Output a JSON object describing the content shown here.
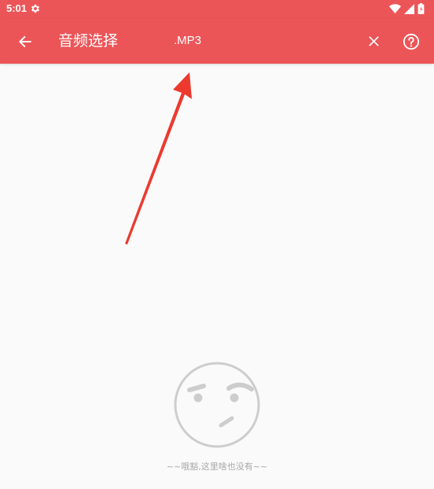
{
  "status_bar": {
    "time": "5:01",
    "icons": [
      "gear-icon",
      "wifi-icon",
      "signal-icon",
      "battery-icon"
    ]
  },
  "app_bar": {
    "title": "音频选择",
    "extension_filter": ".MP3",
    "background_color": "#ec5558",
    "icons": [
      "back-arrow-icon",
      "close-icon",
      "help-icon"
    ]
  },
  "annotation": {
    "color": "#ec3a2f"
  },
  "empty_state": {
    "icon": "confused-face-icon",
    "message": "~~哦豁,这里啥也没有~~"
  }
}
